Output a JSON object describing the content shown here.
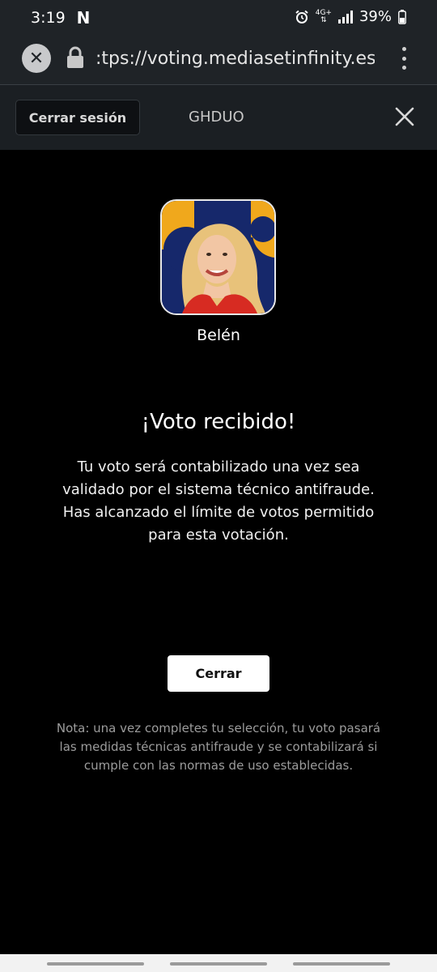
{
  "status_bar": {
    "time": "3:19",
    "app_badge": "N",
    "network": "4G+",
    "battery": "39%"
  },
  "browser": {
    "url": ":tps://voting.mediasetinfinity.es/e"
  },
  "header": {
    "logout_label": "Cerrar sesión",
    "program_name": "GHDUO"
  },
  "candidate": {
    "name": "Belén"
  },
  "confirmation": {
    "title": "¡Voto recibido!",
    "message": "Tu voto será contabilizado una vez sea validado por el sistema técnico antifraude. Has alcanzado el límite de votos permitido para esta votación.",
    "close_label": "Cerrar",
    "note": "Nota: una vez completes tu selección, tu voto pasará las medidas técnicas antifraude y se contabilizará si cumple con las normas de uso establecidas."
  },
  "colors": {
    "background": "#000000",
    "header_bg": "#1b1f23",
    "browser_bg": "#1f2327",
    "avatar_bg": "#16286b",
    "avatar_accent": "#f0a81c",
    "jacket": "#d72b22"
  }
}
